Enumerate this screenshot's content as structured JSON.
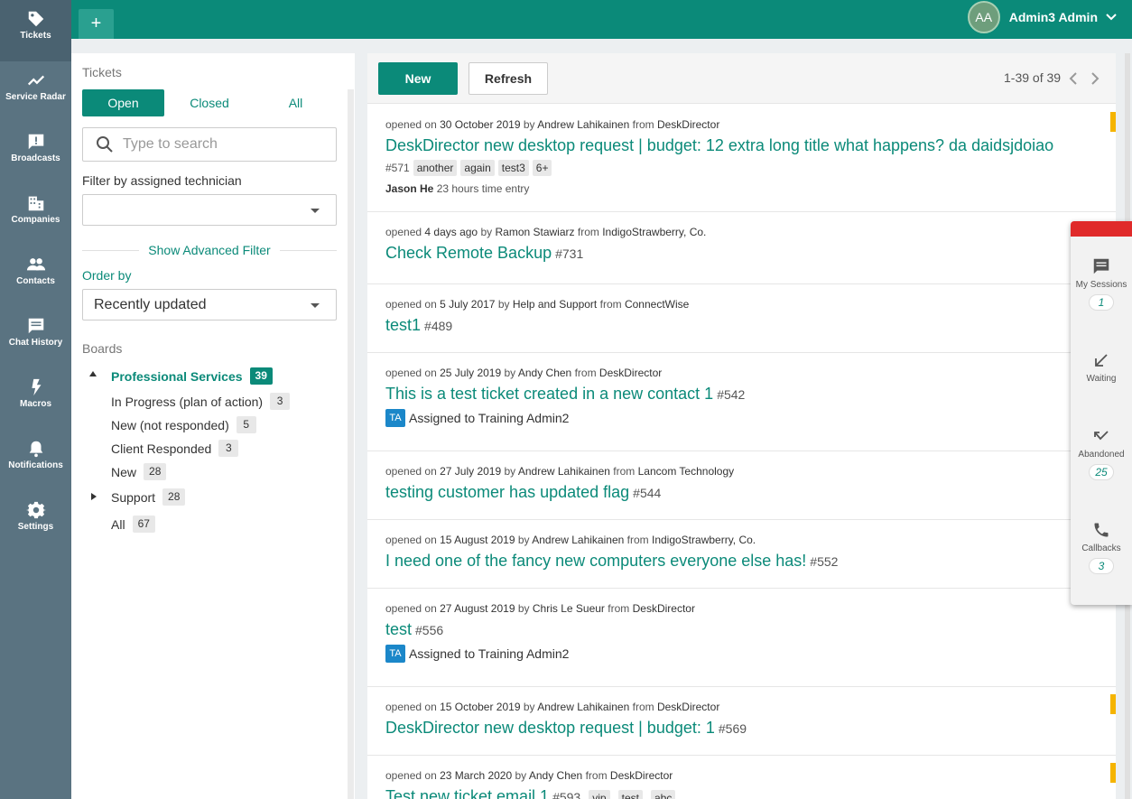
{
  "rail": {
    "items": [
      {
        "label": "Tickets",
        "icon": "tag-icon"
      },
      {
        "label": "Service Radar",
        "icon": "trend-icon"
      },
      {
        "label": "Broadcasts",
        "icon": "alert-message-icon"
      },
      {
        "label": "Companies",
        "icon": "building-icon"
      },
      {
        "label": "Contacts",
        "icon": "people-icon"
      },
      {
        "label": "Chat History",
        "icon": "chat-icon"
      },
      {
        "label": "Macros",
        "icon": "lightning-icon"
      },
      {
        "label": "Notifications",
        "icon": "bell-icon"
      },
      {
        "label": "Settings",
        "icon": "gear-icon"
      }
    ]
  },
  "topbar": {
    "plus": "+",
    "user_initials": "AA",
    "user_name": "Admin3 Admin"
  },
  "filters": {
    "title": "Tickets",
    "tabs": [
      "Open",
      "Closed",
      "All"
    ],
    "search_placeholder": "Type to search",
    "technician_label": "Filter by assigned technician",
    "technician_value": "",
    "advanced": "Show Advanced Filter",
    "order_label": "Order by",
    "order_value": "Recently updated",
    "boards_label": "Boards",
    "boards": {
      "ps": {
        "label": "Professional Services",
        "count": "39"
      },
      "ps_items": [
        {
          "label": "In Progress (plan of action)",
          "count": "3"
        },
        {
          "label": "New (not responded)",
          "count": "5"
        },
        {
          "label": "Client Responded",
          "count": "3"
        },
        {
          "label": "New",
          "count": "28"
        }
      ],
      "support": {
        "label": "Support",
        "count": "28"
      },
      "all": {
        "label": "All",
        "count": "67"
      }
    }
  },
  "toolbar": {
    "new_label": "New",
    "refresh_label": "Refresh",
    "pager": "1-39 of 39"
  },
  "tickets": [
    {
      "date": "30 October 2019",
      "author": "Andrew Lahikainen",
      "company": "DeskDirector",
      "title": "DeskDirector new desktop request | budget: 12 extra long title what happens? da daidsjdoiao",
      "num": "#571",
      "tags": [
        "another",
        "again",
        "test3",
        "6+"
      ],
      "entry_tech": "Jason He",
      "entry_text": "23 hours time entry"
    },
    {
      "date": "4 days ago",
      "author": "Ramon Stawiarz",
      "company": "IndigoStrawberry, Co.",
      "title": "Check Remote Backup",
      "num": "#731"
    },
    {
      "date": "5 July 2017",
      "author": "Help and Support",
      "company": "ConnectWise",
      "title": "test1",
      "num": "#489"
    },
    {
      "date": "25 July 2019",
      "author": "Andy Chen",
      "company": "DeskDirector",
      "title": "This is a test ticket created in a new contact 1",
      "num": "#542",
      "assigned_initials": "TA",
      "assigned": "Assigned to Training Admin2"
    },
    {
      "date": "27 July 2019",
      "author": "Andrew Lahikainen",
      "company": "Lancom Technology",
      "title": "testing customer has updated flag",
      "num": "#544"
    },
    {
      "date": "15 August 2019",
      "author": "Andrew Lahikainen",
      "company": "IndigoStrawberry, Co.",
      "title": "I need one of the fancy new computers everyone else has!",
      "num": "#552"
    },
    {
      "date": "27 August 2019",
      "author": "Chris Le Sueur",
      "company": "DeskDirector",
      "title": "test",
      "num": "#556",
      "assigned_initials": "TA",
      "assigned": "Assigned to Training Admin2"
    },
    {
      "date": "15 October 2019",
      "author": "Andrew Lahikainen",
      "company": "DeskDirector",
      "title": "DeskDirector new desktop request | budget: 1",
      "num": "#569"
    },
    {
      "date": "23 March 2020",
      "author": "Andy Chen",
      "company": "DeskDirector",
      "title": "Test new ticket email 1",
      "num": "#593",
      "tags": [
        "vip",
        "test",
        "abc"
      ]
    }
  ],
  "ticket_words": {
    "opened": "opened",
    "on": "on",
    "by": "by",
    "from": "from"
  },
  "widget": {
    "my_sessions": {
      "label": "My Sessions",
      "count": "1"
    },
    "waiting": {
      "label": "Waiting"
    },
    "abandoned": {
      "label": "Abandoned",
      "count": "25"
    },
    "callbacks": {
      "label": "Callbacks",
      "count": "3"
    }
  },
  "colors": {
    "brand": "#0b8a79",
    "rail": "#5a7381",
    "flag_yellow": "#f5b400",
    "flag_red": "#e02a2a"
  }
}
